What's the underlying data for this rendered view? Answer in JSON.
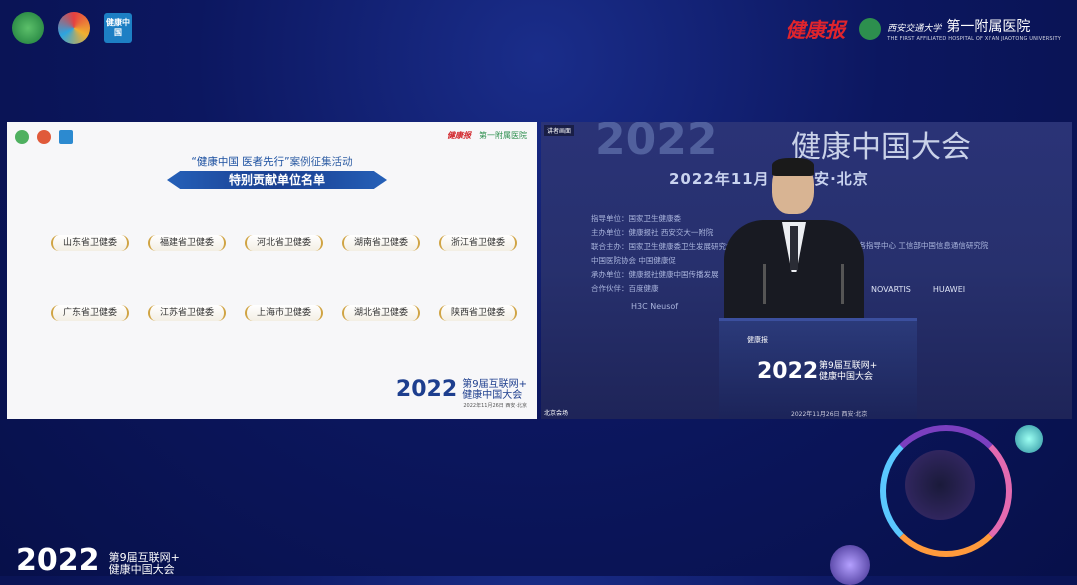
{
  "header": {
    "left_logos": [
      "logo-a",
      "logo-b",
      "健康中国"
    ],
    "right_calligraphy": "健康报",
    "hospital_name": "第一附属医院",
    "hospital_university": "西安交通大学",
    "hospital_english": "THE FIRST AFFILIATED HOSPITAL OF XI'AN JIAOTONG UNIVERSITY"
  },
  "slide": {
    "subtitle_quote": "“健康中国 医者先行”",
    "subtitle_rest": "案例征集活动",
    "banner": "特别贡献单位名单",
    "mini_calligraphy": "健康报",
    "mini_hospital": "第一附属医院",
    "row1": [
      "山东省卫健委",
      "福建省卫健委",
      "河北省卫健委",
      "湖南省卫健委",
      "浙江省卫健委"
    ],
    "row2": [
      "广东省卫健委",
      "江苏省卫健委",
      "上海市卫健委",
      "湖北省卫健委",
      "陕西省卫健委"
    ],
    "footer_year": "2022",
    "footer_line1": "第9届互联网+",
    "footer_line2": "健康中国大会",
    "footer_date": "2022年11月26日 西安·北京"
  },
  "video": {
    "big_year": "2022",
    "conference": "健康中国大会",
    "date": "2022年11月 日 西安·北京",
    "info_lines": [
      "指导单位：国家卫生健康委",
      "主办单位：健康报社  西安交大一附院",
      "联合主办：国家卫生健康委卫生发展研究中",
      "          中国医院协会  中国健康促",
      "承办单位：健康报社健康中国传播发展",
      "合作伙伴：百度健康"
    ],
    "right_info": "服务指导中心  工信部中国信息通信研究院",
    "brands": [
      "NOVARTIS",
      "HUAWEI"
    ],
    "sponsors2": "H3C   Neusof",
    "tag_top": "讲者画面",
    "tag_bottom": "北京会场",
    "podium_year": "2022",
    "podium_line1": "第9届互联网+",
    "podium_line2": "健康中国大会",
    "podium_date": "2022年11月26日  西安·北京",
    "podium_calligraphy": "健康报"
  },
  "bottom": {
    "year": "2022",
    "line1": "第9届互联网+",
    "line2": "健康中国大会"
  }
}
